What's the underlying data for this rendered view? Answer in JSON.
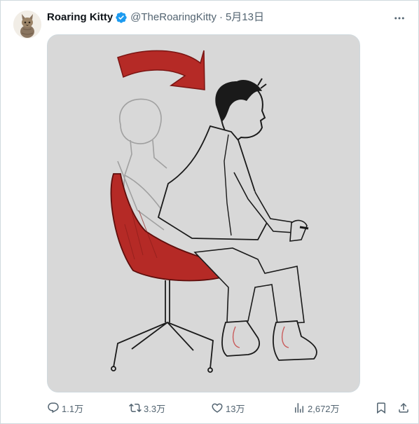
{
  "author": {
    "display_name": "Roaring Kitty",
    "handle": "@TheRoaringKitty",
    "separator": "·",
    "date": "5月13日",
    "verified": true,
    "verified_color": "#1d9bf0"
  },
  "avatar": {
    "icon": "kitten-avatar"
  },
  "media": {
    "description_icon": "chair-lean-forward-drawing",
    "accent_color": "#b52a26"
  },
  "actions": {
    "reply_count": "1.1万",
    "retweet_count": "3.3万",
    "like_count": "13万",
    "view_count": "2,672万"
  },
  "colors": {
    "text_primary": "#0f1419",
    "text_secondary": "#536471",
    "border": "#cfd9de"
  }
}
